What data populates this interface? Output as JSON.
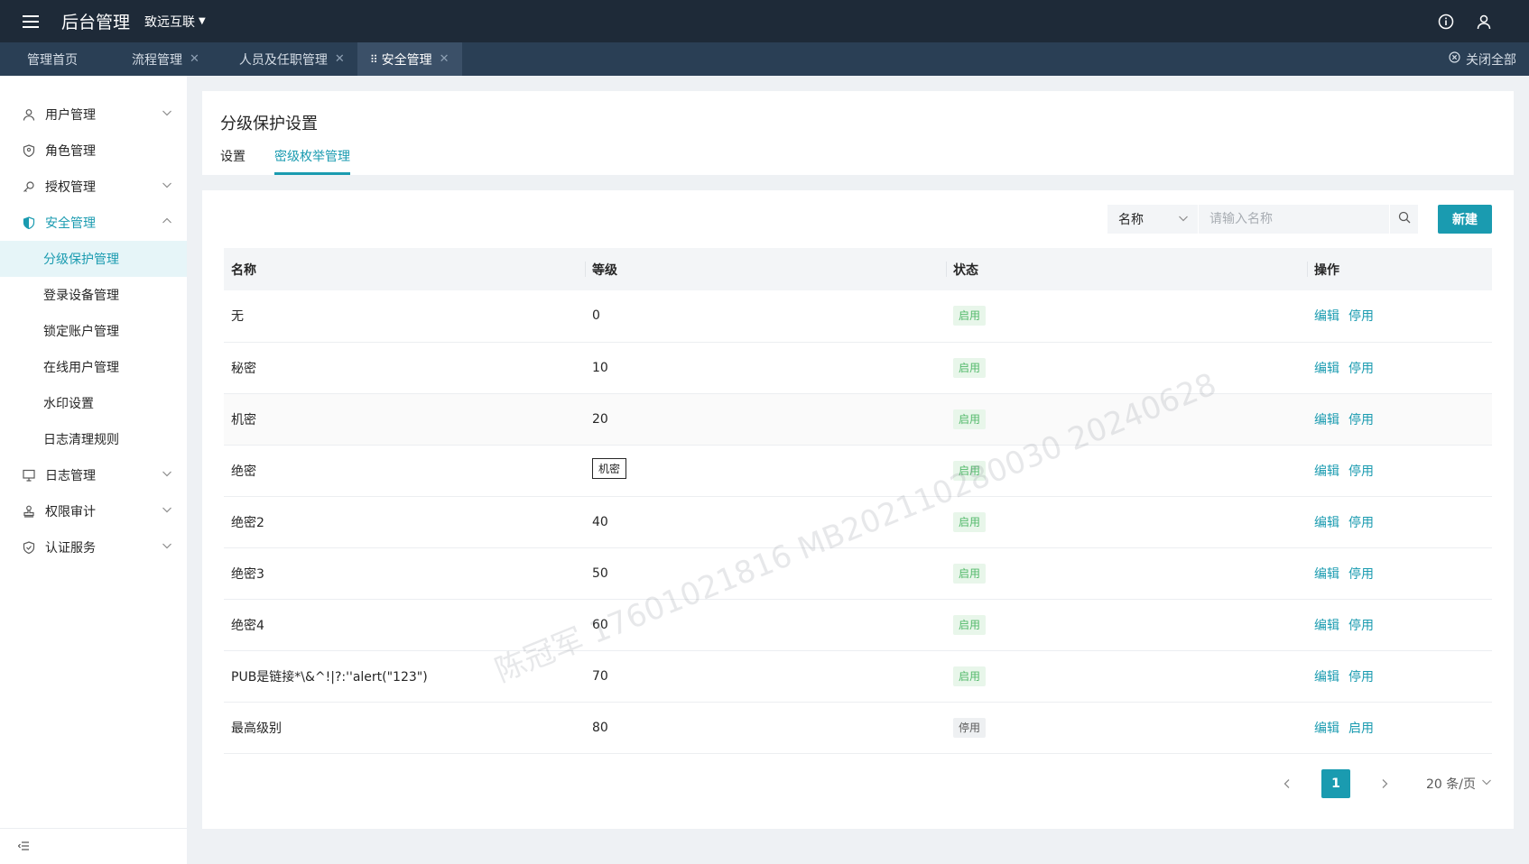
{
  "header": {
    "title": "后台管理",
    "org": "致远互联",
    "icons": [
      "menu-icon",
      "info-icon",
      "user-icon"
    ]
  },
  "page_tabs": [
    {
      "label": "管理首页",
      "closable": false,
      "active": false
    },
    {
      "label": "流程管理",
      "closable": true,
      "active": false
    },
    {
      "label": "人员及任职管理",
      "closable": true,
      "active": false
    },
    {
      "label": "安全管理",
      "closable": true,
      "active": true
    }
  ],
  "close_all": "关闭全部",
  "sidebar": {
    "items": [
      {
        "label": "用户管理",
        "icon": "user-icon"
      },
      {
        "label": "角色管理",
        "icon": "role-icon"
      },
      {
        "label": "授权管理",
        "icon": "key-icon"
      },
      {
        "label": "安全管理",
        "icon": "shield-icon"
      },
      {
        "label": "日志管理",
        "icon": "monitor-icon"
      },
      {
        "label": "权限审计",
        "icon": "stamp-icon"
      },
      {
        "label": "认证服务",
        "icon": "shield-check-icon"
      }
    ],
    "sub_items": [
      "分级保护管理",
      "登录设备管理",
      "锁定账户管理",
      "在线用户管理",
      "水印设置",
      "日志清理规则"
    ],
    "active_sub": "分级保护管理"
  },
  "main": {
    "title": "分级保护设置",
    "tabs": [
      "设置",
      "密级枚举管理"
    ],
    "active_tab": "密级枚举管理"
  },
  "toolbar": {
    "filter_select": "名称",
    "search_placeholder": "请输入名称",
    "new_button": "新建"
  },
  "table": {
    "columns": [
      "名称",
      "等级",
      "状态",
      "操作"
    ],
    "rows": [
      {
        "name": "无",
        "level": "0",
        "status": "启用",
        "edit": "编辑",
        "toggle": "停用"
      },
      {
        "name": "秘密",
        "level": "10",
        "status": "启用",
        "edit": "编辑",
        "toggle": "停用"
      },
      {
        "name": "机密",
        "level": "20",
        "status": "启用",
        "edit": "编辑",
        "toggle": "停用"
      },
      {
        "name": "绝密",
        "level": "",
        "status": "启用",
        "edit": "编辑",
        "toggle": "停用"
      },
      {
        "name": "绝密2",
        "level": "40",
        "status": "启用",
        "edit": "编辑",
        "toggle": "停用"
      },
      {
        "name": "绝密3",
        "level": "50",
        "status": "启用",
        "edit": "编辑",
        "toggle": "停用"
      },
      {
        "name": "绝密4",
        "level": "60",
        "status": "启用",
        "edit": "编辑",
        "toggle": "停用"
      },
      {
        "name": "PUB是链接*\\&^!|?:''alert(\"123\")",
        "level": "70",
        "status": "启用",
        "edit": "编辑",
        "toggle": "停用"
      },
      {
        "name": "最高级别",
        "level": "80",
        "status": "停用",
        "edit": "编辑",
        "toggle": "启用"
      }
    ],
    "tooltip": "机密"
  },
  "pagination": {
    "current": "1",
    "page_size": "20 条/页"
  },
  "watermark": "陈冠军 17601021816 MB202110280030 20240628",
  "colors": {
    "accent": "#1a9bb0",
    "header_bg": "#1e2a38",
    "tabs_bg": "#2a3f55",
    "enabled_badge": "#52b96a"
  }
}
